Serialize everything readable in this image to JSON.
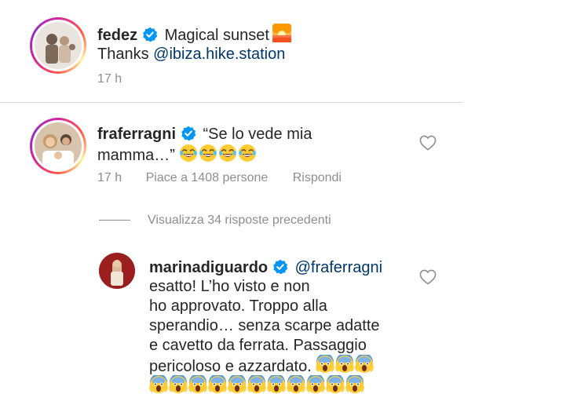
{
  "post": {
    "username": "fedez",
    "caption_text": "Magical sunset",
    "caption_emoji": "sunrise-emoji",
    "thanks_prefix": "Thanks",
    "thanks_mention": "@ibiza.hike.station",
    "time": "17 h"
  },
  "comment1": {
    "username": "fraferragni",
    "text_line1": "“Se lo vede mia",
    "text_line2": "mamma…”",
    "emoji": "laughing-tears-emoji",
    "emoji_count": 4,
    "time": "17 h",
    "likes": "Piace a 1408 persone",
    "reply": "Rispondi"
  },
  "view_replies": "Visualizza 34 risposte precedenti",
  "reply1": {
    "username": "marinadiguardo",
    "mention": "@fraferragni",
    "lines": [
      "esatto! L’ho visto e non",
      "ho approvato. Troppo alla",
      "sperandio… senza scarpe adatte",
      "e cavetto da ferrata. Passaggio",
      "pericoloso e azzardato."
    ],
    "emoji": "screaming-face-emoji",
    "emoji_inline_count": 3,
    "emoji_row_count": 11
  },
  "colors": {
    "text": "#262626",
    "muted": "#8e8e8e",
    "mention": "#00376b",
    "verified": "#0095f6"
  }
}
